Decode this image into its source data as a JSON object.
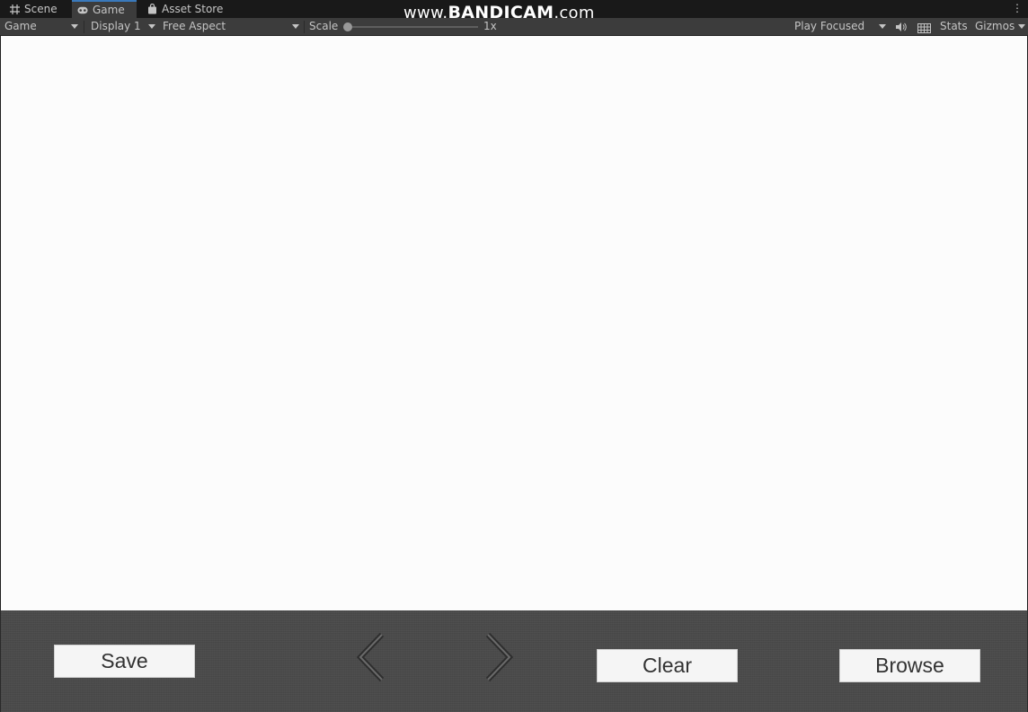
{
  "tabs": [
    {
      "label": "Scene",
      "icon": "grid-icon"
    },
    {
      "label": "Game",
      "icon": "gamepad-icon",
      "active": true
    },
    {
      "label": "Asset Store",
      "icon": "store-bag-icon"
    }
  ],
  "watermark": {
    "prefix": "www.",
    "brand": "BANDICAM",
    "suffix": ".com"
  },
  "toolbar": {
    "view_mode": "Game",
    "display": "Display 1",
    "aspect": "Free Aspect",
    "scale_label": "Scale",
    "scale_value": "1x",
    "play_mode": "Play Focused",
    "audio_icon": "speaker-icon",
    "grid_icon": "keyboard-grid-icon",
    "stats": "Stats",
    "gizmos": "Gizmos"
  },
  "panel": {
    "save": "Save",
    "prev_icon": "chevron-left-icon",
    "next_icon": "chevron-right-icon",
    "clear": "Clear",
    "browse": "Browse"
  },
  "colors": {
    "accent": "#3a79bb",
    "toolbar_bg": "#3c3c3c",
    "viewport_bg": "#fcfcfc",
    "panel_bg": "#4a4a4a",
    "button_bg": "#f5f5f5"
  }
}
